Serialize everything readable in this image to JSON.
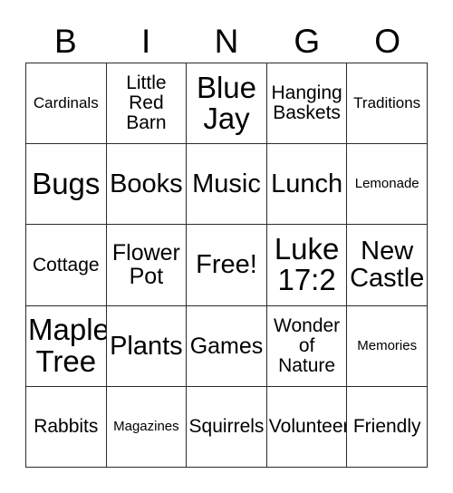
{
  "card": {
    "header": {
      "letters": [
        "B",
        "I",
        "N",
        "G",
        "O"
      ]
    },
    "grid": {
      "columns": 5,
      "rows": 5,
      "free_space_label": "Free!",
      "cells": [
        {
          "text": "Cardinals",
          "size": "fs-sm"
        },
        {
          "text": "Little\nRed\nBarn",
          "size": "fs-md"
        },
        {
          "text": "Blue\nJay",
          "size": "fs-xxl"
        },
        {
          "text": "Hanging\nBaskets",
          "size": "fs-md"
        },
        {
          "text": "Traditions",
          "size": "fs-sm"
        },
        {
          "text": "Bugs",
          "size": "fs-xxl"
        },
        {
          "text": "Books",
          "size": "fs-xl"
        },
        {
          "text": "Music",
          "size": "fs-xl"
        },
        {
          "text": "Lunch",
          "size": "fs-xl"
        },
        {
          "text": "Lemonade",
          "size": "fs-xs"
        },
        {
          "text": "Cottage",
          "size": "fs-md"
        },
        {
          "text": "Flower\nPot",
          "size": "fs-lg"
        },
        {
          "text": "Free!",
          "size": "fs-xl"
        },
        {
          "text": "Luke\n17:2",
          "size": "fs-xxl"
        },
        {
          "text": "New\nCastle",
          "size": "fs-xl"
        },
        {
          "text": "Maple\nTree",
          "size": "fs-xxl"
        },
        {
          "text": "Plants",
          "size": "fs-xl"
        },
        {
          "text": "Games",
          "size": "fs-lg"
        },
        {
          "text": "Wonder\nof\nNature",
          "size": "fs-md"
        },
        {
          "text": "Memories",
          "size": "fs-xs"
        },
        {
          "text": "Rabbits",
          "size": "fs-md"
        },
        {
          "text": "Magazines",
          "size": "fs-xs"
        },
        {
          "text": "Squirrels",
          "size": "fs-md"
        },
        {
          "text": "Volunteer",
          "size": "fs-md"
        },
        {
          "text": "Friendly",
          "size": "fs-md"
        }
      ]
    },
    "colors": {
      "background": "#ffffff",
      "text": "#000000",
      "border": "#2b2b2b"
    }
  }
}
